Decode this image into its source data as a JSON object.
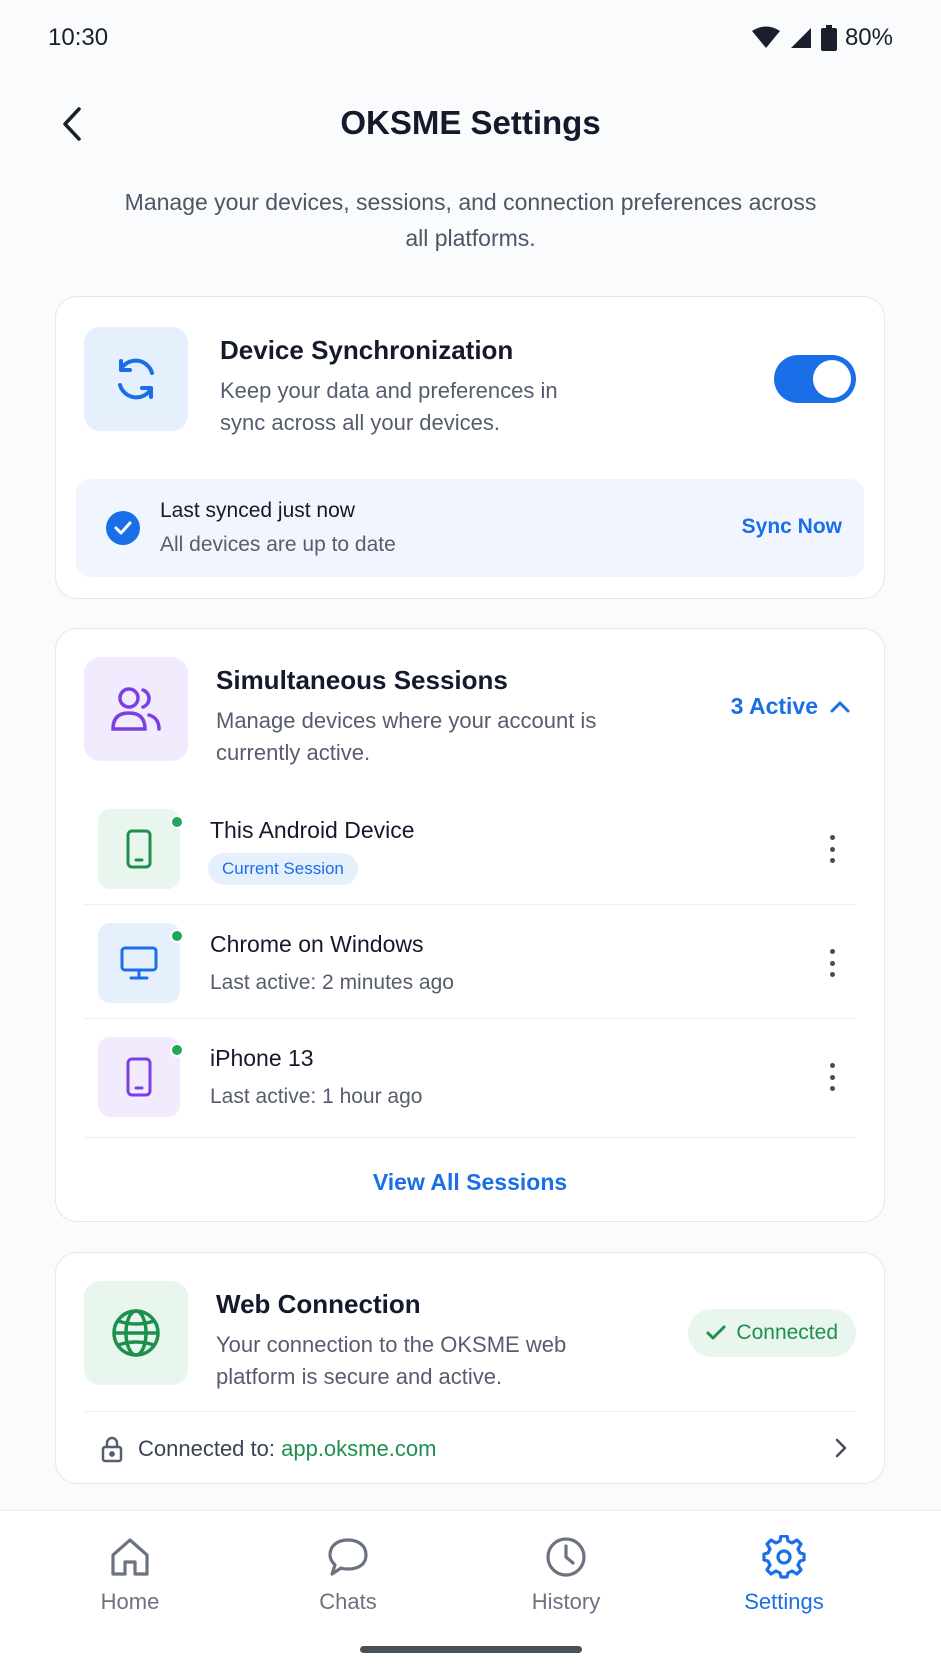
{
  "status_bar": {
    "time": "10:30",
    "battery": "80%"
  },
  "header": {
    "title": "OKSME Settings"
  },
  "subtitle": "Manage your devices, sessions, and connection preferences across all platforms.",
  "sync_card": {
    "title": "Device Synchronization",
    "description": "Keep your data and preferences in sync across all your devices.",
    "toggle_on": true,
    "status_title": "Last synced just now",
    "status_sub": "All devices are up to date",
    "sync_now": "Sync Now"
  },
  "sessions_card": {
    "title": "Simultaneous Sessions",
    "description": "Manage devices where your account is currently active.",
    "active_count": "3 Active",
    "sessions": [
      {
        "name": "This Android Device",
        "badge": "Current Session",
        "icon": "smartphone-icon"
      },
      {
        "name": "Chrome on Windows",
        "subtitle": "Last active: 2 minutes ago",
        "icon": "monitor-icon"
      },
      {
        "name": "iPhone 13",
        "subtitle": "Last active: 1 hour ago",
        "icon": "smartphone-icon"
      }
    ],
    "view_all": "View All Sessions"
  },
  "web_card": {
    "title": "Web Connection",
    "description": "Your connection to the OKSME web platform is secure and active.",
    "status": "Connected",
    "connected_label": "Connected to:",
    "connected_url": "app.oksme.com"
  },
  "bottom_nav": {
    "items": [
      {
        "label": "Home",
        "icon": "home-icon"
      },
      {
        "label": "Chats",
        "icon": "chat-icon"
      },
      {
        "label": "History",
        "icon": "clock-icon"
      },
      {
        "label": "Settings",
        "icon": "gear-icon",
        "active": true
      }
    ]
  },
  "colors": {
    "accent": "#1a6fe8",
    "success": "#1e8f4f",
    "online": "#21a65a",
    "purple": "#7b3fe4"
  }
}
